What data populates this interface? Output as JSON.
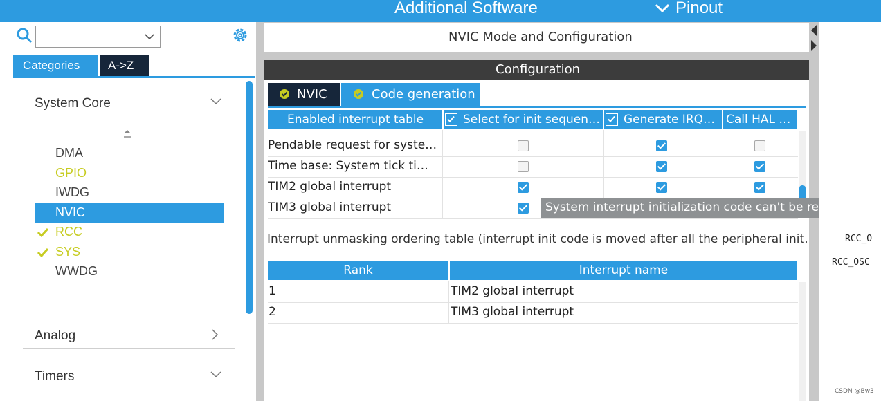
{
  "header": {
    "additional_software": "Additional Software",
    "pinout": "Pinout",
    "pinout_chevron": "chevron-down-icon"
  },
  "left_panel": {
    "search": {
      "value": "",
      "icon": "search-icon"
    },
    "settings_icon": "gear-icon",
    "tabs": [
      "Categories",
      "A->Z"
    ],
    "sections": {
      "system_core": "System Core",
      "analog": "Analog",
      "timers": "Timers"
    },
    "items": [
      {
        "label": "DMA",
        "color": "#444444",
        "check": false,
        "selected": false
      },
      {
        "label": "GPIO",
        "color": "#c7cc22",
        "check": false,
        "selected": false
      },
      {
        "label": "IWDG",
        "color": "#444444",
        "check": false,
        "selected": false
      },
      {
        "label": "NVIC",
        "color": "#ffffff",
        "check": false,
        "selected": true
      },
      {
        "label": "RCC",
        "color": "#c7cc22",
        "check": true,
        "selected": false
      },
      {
        "label": "SYS",
        "color": "#c7cc22",
        "check": true,
        "selected": false
      },
      {
        "label": "WWDG",
        "color": "#444444",
        "check": false,
        "selected": false
      }
    ],
    "accent": "#2d9be0"
  },
  "main": {
    "mode_title": "NVIC Mode and Configuration",
    "config_title": "Configuration",
    "tabs": [
      "NVIC",
      "Code generation"
    ],
    "enabled_table": {
      "headers": [
        "Enabled interrupt table",
        "Select for init sequen…",
        "Generate IRQ…",
        "Call HAL …"
      ],
      "rows": [
        {
          "name": "Pendable request for syste…",
          "c1": false,
          "c2": true,
          "c3": false
        },
        {
          "name": "Time base: System tick ti…",
          "c1": false,
          "c2": true,
          "c3": true
        },
        {
          "name": "TIM2 global interrupt",
          "c1": true,
          "c2": true,
          "c3": true
        },
        {
          "name": "TIM3 global interrupt",
          "c1": true,
          "c2": null,
          "c3": null
        }
      ]
    },
    "tooltip": "System interrupt initialization code can't be relocated",
    "unmask_label": "Interrupt unmasking ordering table (interrupt init code is moved after all the peripheral init…",
    "rank_table": {
      "headers": [
        "Rank",
        "Interrupt name"
      ],
      "rows": [
        {
          "rank": "1",
          "name": "TIM2 global interrupt"
        },
        {
          "rank": "2",
          "name": "TIM3 global interrupt"
        }
      ]
    }
  },
  "right_panel": {
    "labels": [
      "RCC_O",
      "RCC_OSC"
    ],
    "watermark": "CSDN @Bw3"
  }
}
